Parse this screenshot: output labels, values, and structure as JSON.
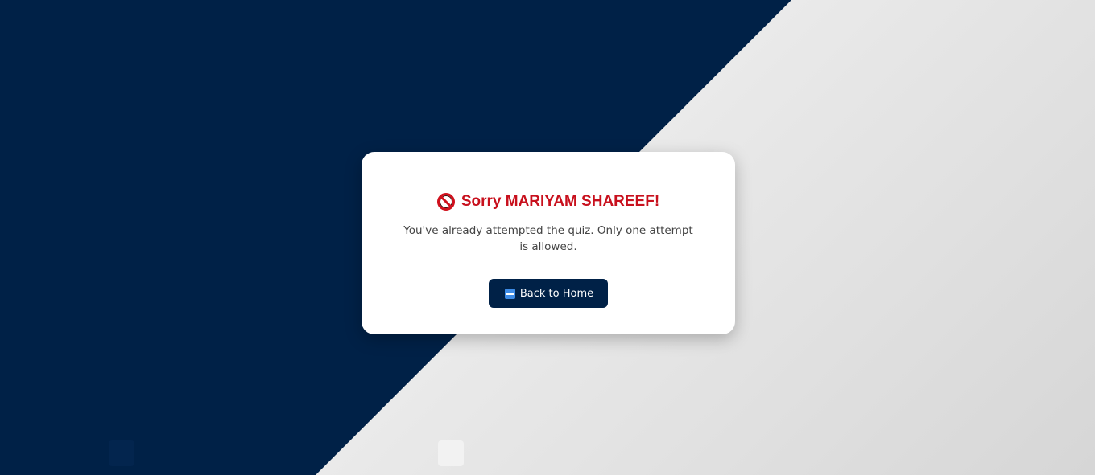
{
  "card": {
    "title": "Sorry MARIYAM SHAREEF!",
    "message": "You've already attempted the quiz. Only one attempt is allowed.",
    "back_button_label": "Back to Home"
  },
  "icons": {
    "title_icon": "prohibited-icon",
    "button_icon": "back-icon"
  },
  "colors": {
    "primary_navy": "#002147",
    "error_red": "#c8101d"
  }
}
